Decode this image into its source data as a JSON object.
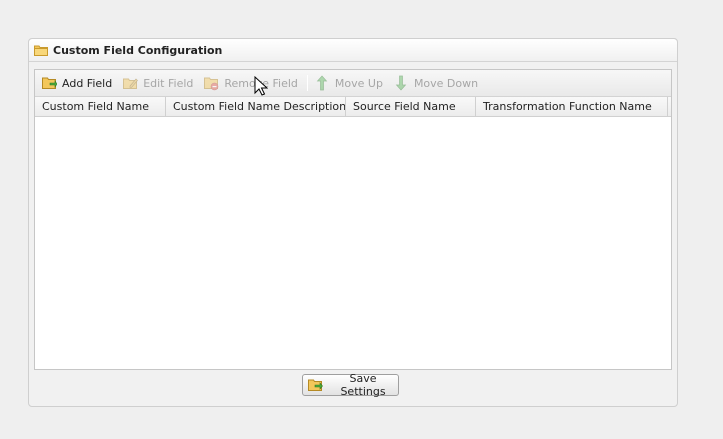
{
  "panel": {
    "title": "Custom Field Configuration",
    "icon": "folder-icon"
  },
  "toolbar": {
    "add_field": "Add Field",
    "edit_field": "Edit Field",
    "remove_field": "Remove Field",
    "move_up": "Move Up",
    "move_down": "Move Down"
  },
  "grid": {
    "columns": [
      "Custom Field Name",
      "Custom Field Name Description",
      "Source Field Name",
      "Transformation Function Name"
    ],
    "rows": []
  },
  "footer": {
    "save_label": "Save Settings"
  },
  "colors": {
    "background": "#efefef",
    "panel_border": "#cfcfcf",
    "disabled_text": "#a6a6a6",
    "arrow_green": "#5cb85c"
  }
}
